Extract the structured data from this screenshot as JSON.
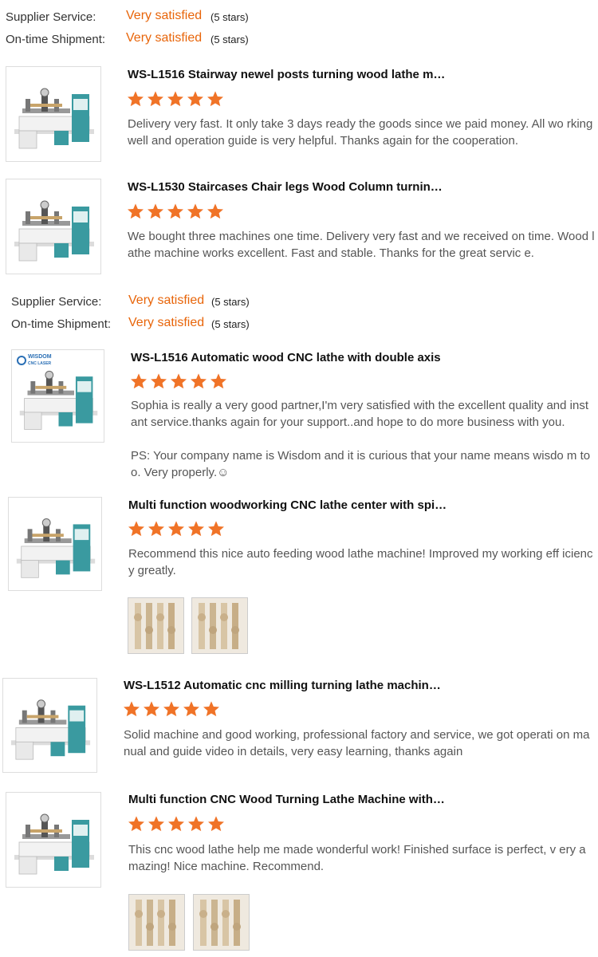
{
  "ratings_top": {
    "supplier_label": "Supplier Service:",
    "supplier_value": "Very satisfied",
    "supplier_stars": "(5 stars)",
    "shipment_label": "On-time Shipment:",
    "shipment_value": "Very satisfied",
    "shipment_stars": "(5 stars)"
  },
  "ratings_mid": {
    "supplier_label": "Supplier Service:",
    "supplier_value": "Very satisfied",
    "supplier_stars": "(5 stars)",
    "shipment_label": "On-time Shipment:",
    "shipment_value": "Very satisfied",
    "shipment_stars": "(5 stars)"
  },
  "colors": {
    "accent": "#e8650a",
    "star": "#f07327"
  },
  "reviews": [
    {
      "title": "WS-L1516 Stairway newel posts turning wood lathe m…",
      "rating": 5,
      "text": "Delivery very fast. It only take 3 days ready the goods since we paid money. All wo rking well and operation guide is very helpful. Thanks again for the cooperation."
    },
    {
      "title": "WS-L1530 Staircases Chair legs Wood Column turnin…",
      "rating": 5,
      "text": "We bought three machines one time. Delivery very fast and we received on time. Wood lathe machine works excellent. Fast and stable. Thanks for the great servic e."
    },
    {
      "title": "WS-L1516 Automatic wood CNC lathe with double axis",
      "rating": 5,
      "text": "Sophia is really a very good partner,I'm very satisfied with the excellent quality and instant service.thanks again for your support..and hope to do more business with you.",
      "text2": "PS: Your company name is Wisdom and it is curious that your name means wisdo m too. Very properly.☺",
      "logo_text": "WISDOM",
      "logo_sub": "CNC LASER"
    },
    {
      "title": "Multi function woodworking CNC lathe center with spi…",
      "rating": 5,
      "text": "Recommend this nice auto feeding wood lathe machine! Improved my working eff iciency greatly."
    },
    {
      "title": "WS-L1512 Automatic cnc milling turning lathe machin…",
      "rating": 5,
      "text": "Solid machine and good working, professional factory and service, we got operati on manual and guide video in details, very easy learning, thanks again"
    },
    {
      "title": "Multi function CNC Wood Turning Lathe Machine with…",
      "rating": 5,
      "text": "This cnc wood lathe help me made wonderful work! Finished surface is perfect, v ery amazing! Nice machine. Recommend."
    }
  ]
}
